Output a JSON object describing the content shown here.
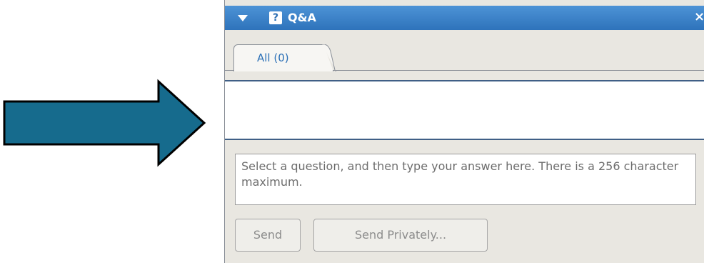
{
  "panel": {
    "title": "Q&A",
    "help_glyph": "?",
    "close_glyph": "×",
    "tabs": [
      {
        "label": "All (0)",
        "selected": true
      }
    ],
    "answer_input": {
      "value": "",
      "placeholder": "Select a question, and then type your answer here. There is a 256 character maximum."
    },
    "buttons": {
      "send_label": "Send",
      "send_privately_label": "Send Privately..."
    }
  },
  "icons": {
    "collapse": "chevron-down-icon",
    "help": "help-icon",
    "close": "close-icon",
    "pointer_arrow": "arrow-right-icon"
  },
  "colors": {
    "titlebar": "#2e73bb",
    "arrow_fill": "#166b8d",
    "arrow_stroke": "#000000",
    "tab_label": "#2a6fb6",
    "panel_bg": "#e9e7e1"
  }
}
